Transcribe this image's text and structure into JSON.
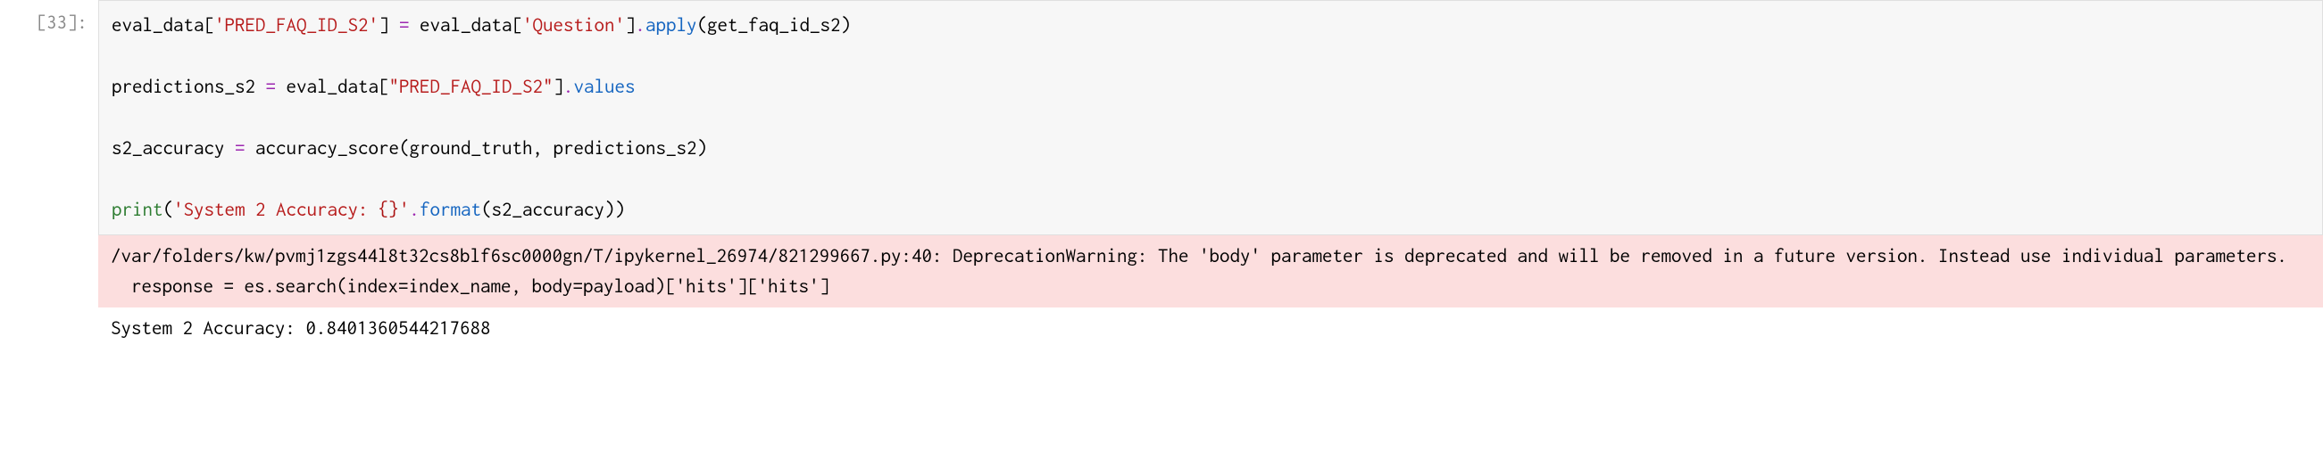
{
  "cell": {
    "prompt": "[33]:",
    "code": {
      "line1": {
        "t1": "eval_data[",
        "s1": "'PRED_FAQ_ID_S2'",
        "t2": "] ",
        "op": "=",
        "t3": " eval_data[",
        "s2": "'Question'",
        "t4": "]",
        "dot": ".",
        "m1": "apply",
        "t5": "(get_faq_id_s2)"
      },
      "blank1": "",
      "line2": {
        "t1": "predictions_s2 ",
        "op": "=",
        "t2": " eval_data[",
        "s1": "\"PRED_FAQ_ID_S2\"",
        "t3": "]",
        "dot": ".",
        "m1": "values"
      },
      "blank2": "",
      "line3": {
        "t1": "s2_accuracy ",
        "op": "=",
        "t2": " accuracy_score(ground_truth, predictions_s2)"
      },
      "blank3": "",
      "line4": {
        "fn": "print",
        "t1": "(",
        "s1": "'System 2 Accuracy: ",
        "fmt": "{}",
        "s2": "'",
        "dot": ".",
        "m1": "format",
        "t2": "(s2_accuracy))"
      }
    },
    "output": {
      "warning": "/var/folders/kw/pvmj1zgs44l8t32cs8blf6sc0000gn/T/ipykernel_26974/821299667.py:40: DeprecationWarning: The 'body' parameter is deprecated and will be removed in a future version. Instead use individual parameters.\n  response = es.search(index=index_name, body=payload)['hits']['hits']",
      "result": "System 2 Accuracy: 0.8401360544217688"
    }
  },
  "chart_data": {
    "type": "table",
    "title": "Jupyter Cell Execution",
    "execution_count": 33,
    "accuracy_value": 0.8401360544217688,
    "accuracy_label": "System 2 Accuracy"
  }
}
